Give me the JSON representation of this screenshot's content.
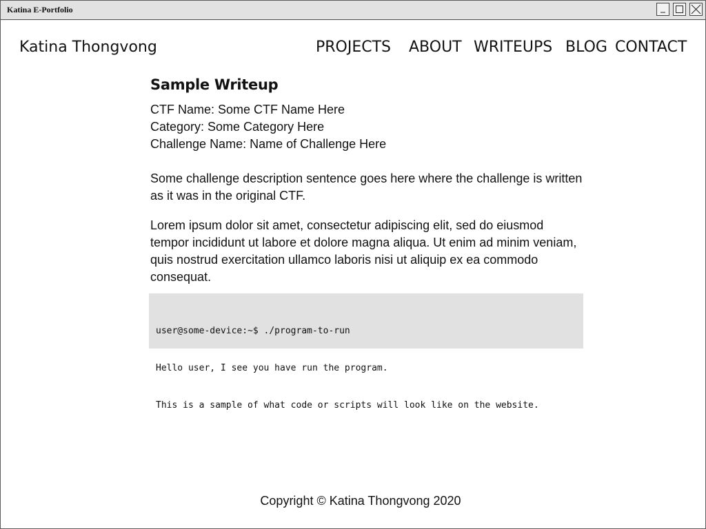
{
  "window": {
    "title": "Katina E-Portfolio"
  },
  "header": {
    "brand": "Katina Thongvong",
    "nav": {
      "projects": "PROJECTS",
      "about": "ABOUT",
      "writeups": "WRITEUPS",
      "blog": "BLOG",
      "contact": "CONTACT"
    }
  },
  "post": {
    "title": "Sample Writeup",
    "ctf_name": "CTF Name: Some CTF Name Here",
    "category": "Category: Some Category Here",
    "challenge_name": "Challenge Name: Name of Challenge Here",
    "description": "Some challenge description sentence goes here where the challenge is written as it was in the original CTF.",
    "body": "Lorem ipsum dolor sit amet, consectetur adipiscing elit, sed do eiusmod tempor incididunt ut labore et dolore magna aliqua. Ut enim ad minim veniam, quis nostrud exercitation ullamco laboris nisi ut aliquip ex ea commodo consequat.",
    "code_lines": [
      "user@some-device:~$ ./program-to-run",
      "Hello user, I see you have run the program.",
      "This is a sample of what code or scripts will look like on the website."
    ]
  },
  "footer": {
    "copyright": "Copyright © Katina Thongvong 2020"
  },
  "icons": {
    "minimize": "minimize-icon",
    "maximize": "maximize-icon",
    "close": "close-icon"
  }
}
